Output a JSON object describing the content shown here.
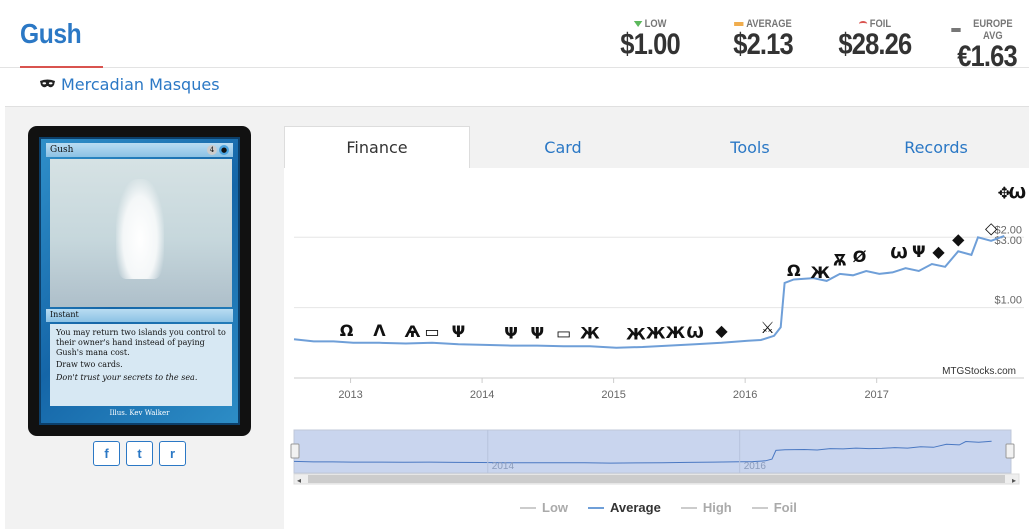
{
  "card": {
    "name": "Gush",
    "set": "Mercadian Masques",
    "image": {
      "title": "Gush",
      "mana": [
        "4",
        "●"
      ],
      "type": "Instant",
      "rules": "You may return two islands you control to their owner's hand instead of paying Gush's mana cost.",
      "draw": "Draw two cards.",
      "flavor": "Don't trust your secrets to the sea.",
      "illus": "Illus. Kev Walker"
    }
  },
  "prices": [
    {
      "label": "LOW",
      "value": "$1.00",
      "marker": "down-triangle",
      "color": "#5cb85c"
    },
    {
      "label": "AVERAGE",
      "value": "$2.13",
      "marker": "bar",
      "color": "#f0ad4e"
    },
    {
      "label": "FOIL",
      "value": "$28.26",
      "marker": "arc",
      "color": "#d9534f"
    },
    {
      "label": "EUROPE AVG",
      "value": "€1.63",
      "marker": "bar",
      "color": "#777777"
    }
  ],
  "share": {
    "facebook": "f",
    "twitter": "t",
    "reddit": "r"
  },
  "tabs": [
    {
      "label": "Finance",
      "active": true
    },
    {
      "label": "Card",
      "active": false
    },
    {
      "label": "Tools",
      "active": false
    },
    {
      "label": "Records",
      "active": false
    }
  ],
  "chart_data": {
    "type": "line",
    "x_ticks": [
      "2013",
      "2014",
      "2015",
      "2016",
      "2017"
    ],
    "y_ticks": [
      "$1.00",
      "$2.00",
      "$3.00"
    ],
    "watermark": "MTGStocks.com",
    "navigator_labels": [
      "2014",
      "2016"
    ],
    "legend": [
      {
        "name": "Low",
        "active": false
      },
      {
        "name": "Average",
        "active": true
      },
      {
        "name": "High",
        "active": false
      },
      {
        "name": "Foil",
        "active": false
      }
    ],
    "series": [
      {
        "name": "Average",
        "color": "#6f9fd8",
        "points": [
          [
            2012.55,
            0.55
          ],
          [
            2012.7,
            0.52
          ],
          [
            2012.85,
            0.52
          ],
          [
            2013.0,
            0.5
          ],
          [
            2013.2,
            0.5
          ],
          [
            2013.4,
            0.49
          ],
          [
            2013.6,
            0.5
          ],
          [
            2013.8,
            0.48
          ],
          [
            2014.0,
            0.47
          ],
          [
            2014.2,
            0.46
          ],
          [
            2014.4,
            0.46
          ],
          [
            2014.6,
            0.45
          ],
          [
            2014.8,
            0.45
          ],
          [
            2015.0,
            0.43
          ],
          [
            2015.2,
            0.44
          ],
          [
            2015.4,
            0.46
          ],
          [
            2015.6,
            0.48
          ],
          [
            2015.8,
            0.5
          ],
          [
            2016.0,
            0.53
          ],
          [
            2016.1,
            0.54
          ],
          [
            2016.2,
            0.6
          ],
          [
            2016.25,
            0.72
          ],
          [
            2016.28,
            1.35
          ],
          [
            2016.35,
            1.4
          ],
          [
            2016.5,
            1.42
          ],
          [
            2016.6,
            1.38
          ],
          [
            2016.7,
            1.48
          ],
          [
            2016.8,
            1.46
          ],
          [
            2016.9,
            1.52
          ],
          [
            2017.0,
            1.48
          ],
          [
            2017.1,
            1.5
          ],
          [
            2017.2,
            1.56
          ],
          [
            2017.3,
            1.52
          ],
          [
            2017.4,
            1.62
          ],
          [
            2017.5,
            1.58
          ],
          [
            2017.6,
            1.8
          ],
          [
            2017.7,
            1.75
          ],
          [
            2017.75,
            2.0
          ],
          [
            2017.85,
            1.95
          ],
          [
            2017.95,
            2.02
          ]
        ]
      }
    ],
    "event_markers": [
      {
        "x": 2012.95,
        "y": 0.6,
        "glyph": "Ω"
      },
      {
        "x": 2013.2,
        "y": 0.6,
        "glyph": "Λ"
      },
      {
        "x": 2013.45,
        "y": 0.58,
        "glyph": "Ѧ"
      },
      {
        "x": 2013.6,
        "y": 0.58,
        "glyph": "▭"
      },
      {
        "x": 2013.8,
        "y": 0.58,
        "glyph": "Ψ"
      },
      {
        "x": 2014.2,
        "y": 0.56,
        "glyph": "Ψ"
      },
      {
        "x": 2014.4,
        "y": 0.56,
        "glyph": "Ψ"
      },
      {
        "x": 2014.6,
        "y": 0.56,
        "glyph": "▭"
      },
      {
        "x": 2014.8,
        "y": 0.56,
        "glyph": "Ж"
      },
      {
        "x": 2015.15,
        "y": 0.55,
        "glyph": "Ж"
      },
      {
        "x": 2015.3,
        "y": 0.56,
        "glyph": "Ж"
      },
      {
        "x": 2015.45,
        "y": 0.57,
        "glyph": "Ж"
      },
      {
        "x": 2015.6,
        "y": 0.57,
        "glyph": "Ѡ"
      },
      {
        "x": 2015.8,
        "y": 0.6,
        "glyph": "◆"
      },
      {
        "x": 2016.15,
        "y": 0.64,
        "glyph": "⚔"
      },
      {
        "x": 2016.35,
        "y": 1.45,
        "glyph": "Ω"
      },
      {
        "x": 2016.55,
        "y": 1.42,
        "glyph": "Ж"
      },
      {
        "x": 2016.7,
        "y": 1.6,
        "glyph": "Ѫ"
      },
      {
        "x": 2016.85,
        "y": 1.65,
        "glyph": "Ø"
      },
      {
        "x": 2017.15,
        "y": 1.7,
        "glyph": "Ѡ"
      },
      {
        "x": 2017.3,
        "y": 1.72,
        "glyph": "Ψ"
      },
      {
        "x": 2017.45,
        "y": 1.72,
        "glyph": "◆"
      },
      {
        "x": 2017.6,
        "y": 1.9,
        "glyph": "◆"
      },
      {
        "x": 2017.85,
        "y": 2.05,
        "glyph": "◇"
      },
      {
        "x": 2017.95,
        "y": 2.55,
        "glyph": "✥"
      },
      {
        "x": 2018.05,
        "y": 2.55,
        "glyph": "Ѡ"
      }
    ]
  }
}
